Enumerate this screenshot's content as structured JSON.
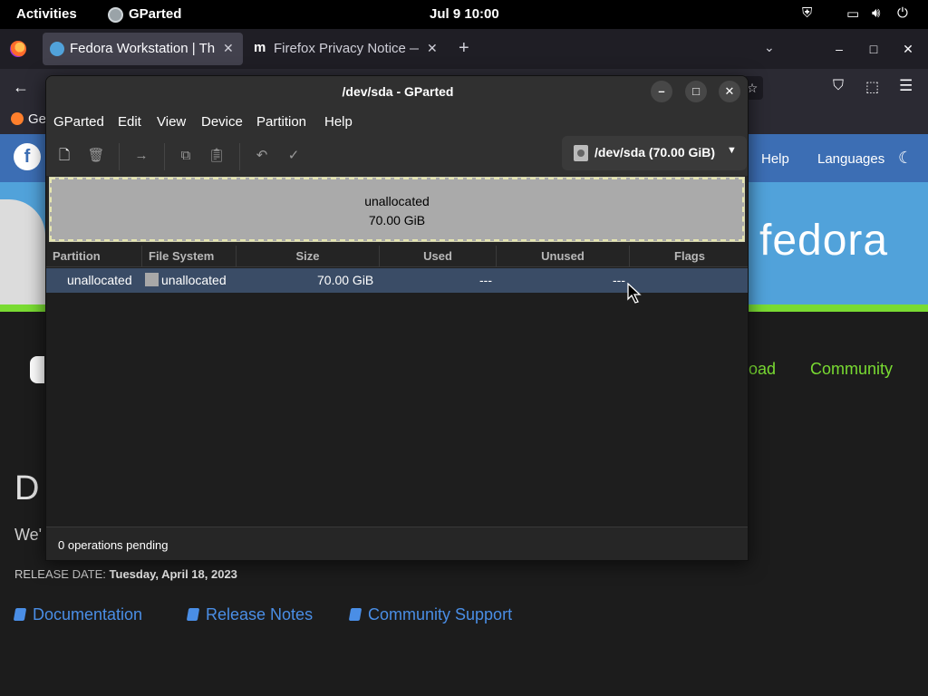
{
  "topbar": {
    "activities": "Activities",
    "app_name": "GParted",
    "clock": "Jul 9  10:00"
  },
  "firefox": {
    "tabs": [
      {
        "label": "Fedora Workstation | Th",
        "active": true
      },
      {
        "label": "Firefox Privacy Notice —",
        "active": false
      }
    ],
    "new_tab": "+",
    "bookmark_label": "Ge"
  },
  "site": {
    "nav": {
      "help": "Help",
      "languages": "Languages"
    },
    "brand": "fedora",
    "links": {
      "download_partial": "oad",
      "community": "Community"
    },
    "heading_partial": "D",
    "subtext_partial": "We'",
    "release_label": "RELEASE DATE:",
    "release_date": "Tuesday, April 18, 2023",
    "bottom_links": [
      "Documentation",
      "Release Notes",
      "Community Support"
    ]
  },
  "gparted": {
    "title": "/dev/sda - GParted",
    "menu": [
      "GParted",
      "Edit",
      "View",
      "Device",
      "Partition",
      "Help"
    ],
    "device_selector": "/dev/sda (70.00 GiB)",
    "disk_map": {
      "label": "unallocated",
      "size": "70.00 GiB"
    },
    "columns": [
      "Partition",
      "File System",
      "Size",
      "Used",
      "Unused",
      "Flags"
    ],
    "rows": [
      {
        "partition": "unallocated",
        "filesystem": "unallocated",
        "size": "70.00 GiB",
        "used": "---",
        "unused": "---",
        "flags": ""
      }
    ],
    "status": "0 operations pending"
  },
  "colors": {
    "fedora_blue": "#51a2da",
    "fedora_dark_blue": "#3c6eb4",
    "fedora_green": "#79db32",
    "selection": "#3a4c66"
  }
}
